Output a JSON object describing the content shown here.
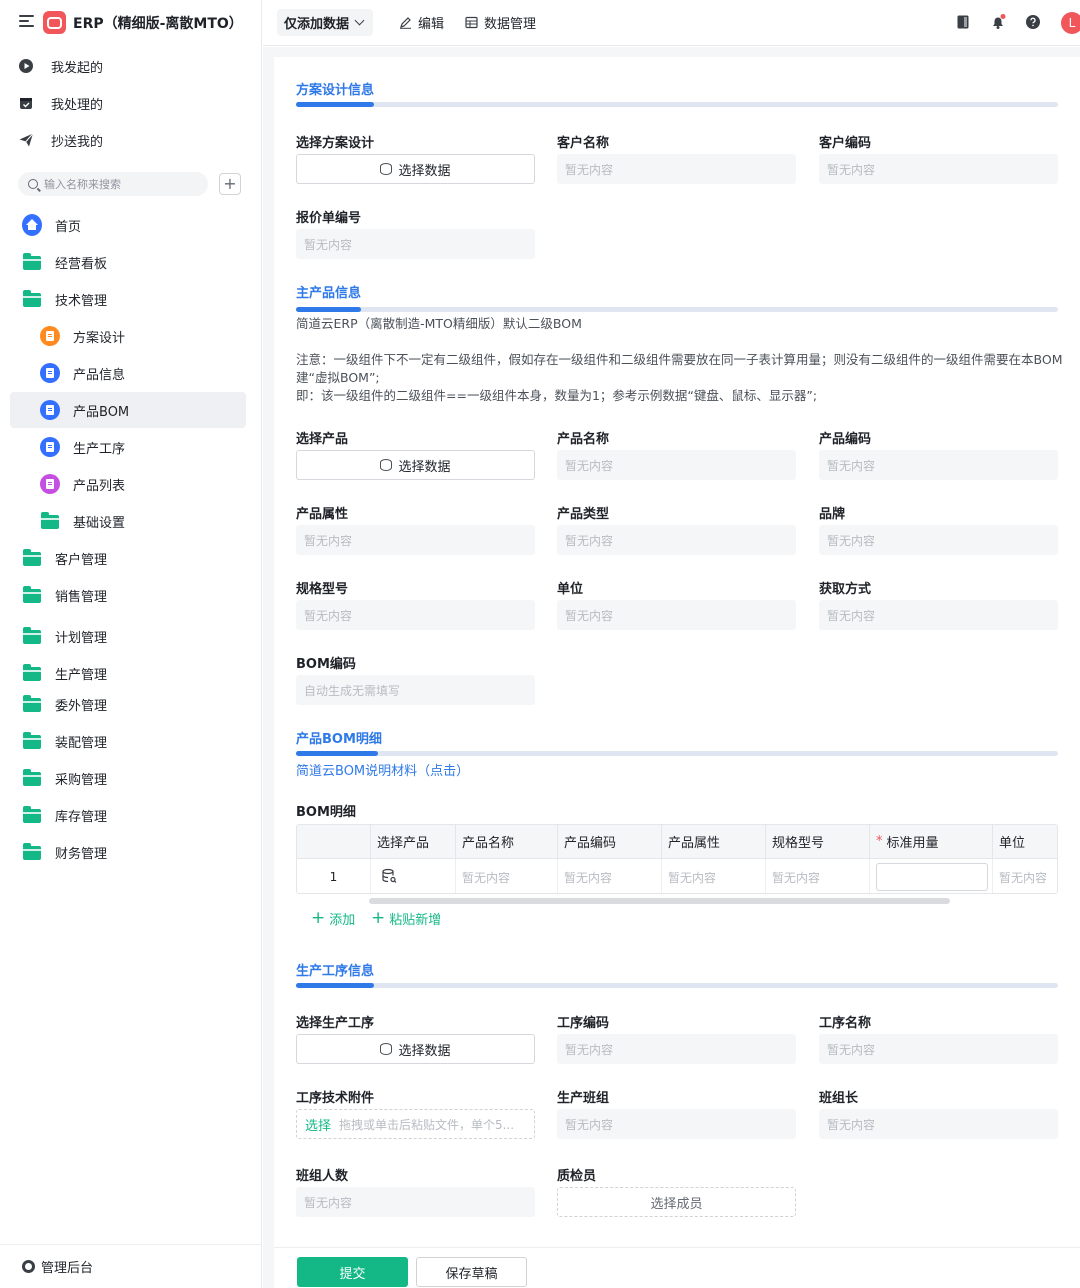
{
  "app": {
    "title": "ERP（精细版-离散MTO）"
  },
  "quick_nav": [
    {
      "label": "我发起的",
      "icon": "play-icon"
    },
    {
      "label": "我处理的",
      "icon": "inbox-check-icon"
    },
    {
      "label": "抄送我的",
      "icon": "send-icon"
    }
  ],
  "search": {
    "placeholder": "输入名称来搜索"
  },
  "sidebar": {
    "items": [
      {
        "label": "首页",
        "icon": "home-icon"
      },
      {
        "label": "经营看板",
        "icon": "folder-icon"
      },
      {
        "label": "技术管理",
        "icon": "folder-open-icon"
      },
      {
        "label": "方案设计",
        "icon": "form-icon"
      },
      {
        "label": "产品信息",
        "icon": "form-icon"
      },
      {
        "label": "产品BOM",
        "icon": "form-icon",
        "active": true
      },
      {
        "label": "生产工序",
        "icon": "form-icon"
      },
      {
        "label": "产品列表",
        "icon": "form-icon"
      },
      {
        "label": "基础设置",
        "icon": "folder-icon"
      },
      {
        "label": "客户管理",
        "icon": "folder-icon"
      },
      {
        "label": "销售管理",
        "icon": "folder-icon"
      },
      {
        "label": "计划管理",
        "icon": "folder-icon"
      },
      {
        "label": "生产管理",
        "icon": "folder-icon"
      },
      {
        "label": "委外管理",
        "icon": "folder-icon"
      },
      {
        "label": "装配管理",
        "icon": "folder-icon"
      },
      {
        "label": "采购管理",
        "icon": "folder-icon"
      },
      {
        "label": "库存管理",
        "icon": "folder-icon"
      },
      {
        "label": "财务管理",
        "icon": "folder-icon"
      }
    ],
    "admin": "管理后台"
  },
  "topbar": {
    "mode": "仅添加数据",
    "edit": "编辑",
    "data_manage": "数据管理",
    "avatar": "L"
  },
  "colors": {
    "primary_blue": "#2f79e8",
    "green": "#14b886",
    "brand_red": "#f0565a",
    "orange": "#ff8a1f",
    "purple": "#c54fe0"
  },
  "sections": {
    "design": {
      "title": "方案设计信息",
      "select_design": "选择方案设计",
      "customer_name": "客户名称",
      "customer_code": "客户编码",
      "quote_no": "报价单编号"
    },
    "product": {
      "title": "主产品信息",
      "desc1": "简道云ERP（离散制造-MTO精细版）默认二级BOM",
      "desc2": "注意：一级组件下不一定有二级组件，假如存在一级组件和二级组件需要放在同一子表计算用量；则没有二级组件的一级组件需要在本BOM建“虚拟BOM”;",
      "desc3": "即：该一级组件的二级组件==一级组件本身，数量为1；参考示例数据“键盘、鼠标、显示器”;",
      "select_product": "选择产品",
      "product_name": "产品名称",
      "product_code": "产品编码",
      "product_attr": "产品属性",
      "product_type": "产品类型",
      "brand": "品牌",
      "spec": "规格型号",
      "unit": "单位",
      "acquire": "获取方式",
      "bom_code": "BOM编码",
      "bom_code_placeholder": "自动生成无需填写"
    },
    "bom": {
      "title": "产品BOM明细",
      "link": "简道云BOM说明材料（点击）",
      "table_label": "BOM明细",
      "columns": [
        "选择产品",
        "产品名称",
        "产品编码",
        "产品属性",
        "规格型号",
        "标准用量",
        "单位"
      ],
      "rows": [
        {
          "index": "1",
          "product_name": "暂无内容",
          "product_code": "暂无内容",
          "product_attr": "暂无内容",
          "spec": "暂无内容",
          "qty": "",
          "unit": "暂无内容"
        }
      ],
      "add": "添加",
      "paste_add": "粘贴新增"
    },
    "process": {
      "title": "生产工序信息",
      "select_process": "选择生产工序",
      "process_code": "工序编码",
      "process_name": "工序名称",
      "tech_attachment": "工序技术附件",
      "upload_select": "选择",
      "upload_hint": "拖拽或单击后粘贴文件，单个5...",
      "team": "生产班组",
      "team_leader": "班组长",
      "team_size": "班组人数",
      "inspector": "质检员",
      "select_member": "选择成员"
    }
  },
  "common": {
    "empty": "暂无内容",
    "select_data": "选择数据"
  },
  "footer": {
    "submit": "提交",
    "save_draft": "保存草稿"
  }
}
